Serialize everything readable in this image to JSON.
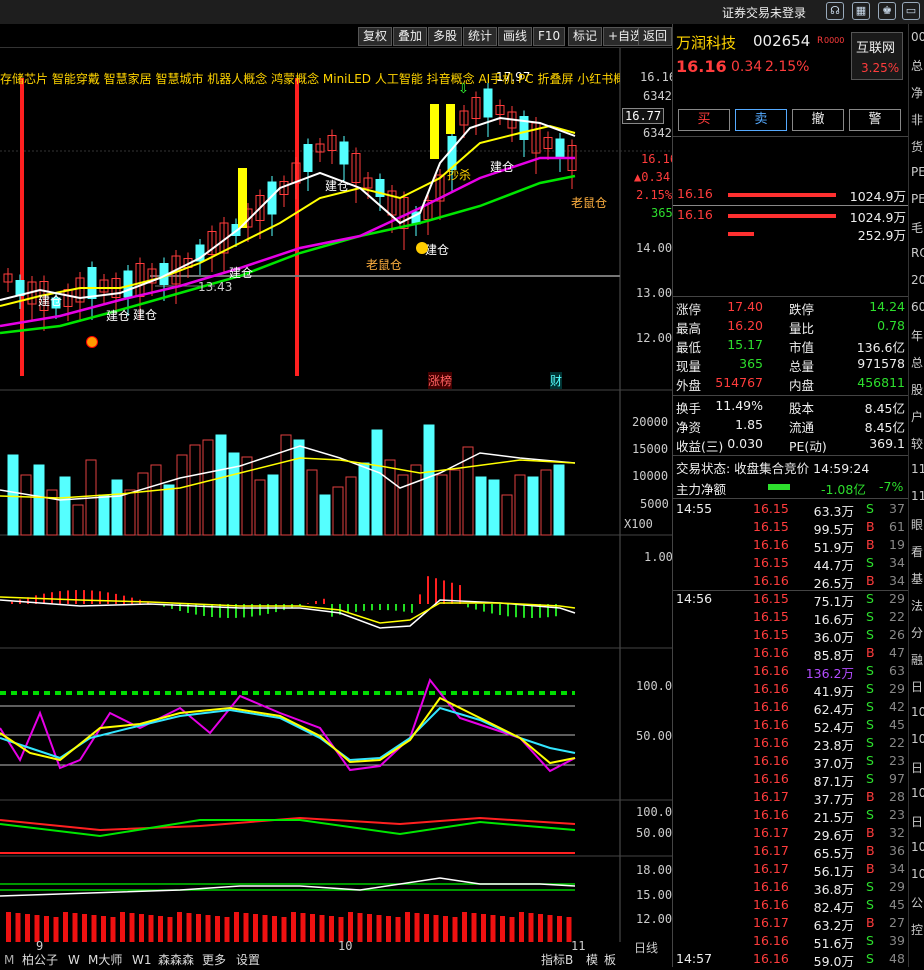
{
  "topbar": {
    "status_text": "证券交易未登录",
    "icons": [
      "headset-icon",
      "calculator-icon",
      "shirt-icon",
      "window-icon"
    ]
  },
  "toolbar": {
    "buttons": [
      "复权",
      "叠加",
      "多股",
      "统计",
      "画线",
      "F10",
      "标记",
      "+自选",
      "返回"
    ]
  },
  "concepts": "存储芯片 智能穿戴 智慧家居 智慧城市 机器人概念 鸿蒙概念 MiniLED 人工智能 抖音概念 AI手机 PC 折叠屏 小红书概",
  "price_axis": {
    "top_value": "16.16",
    "top_vol": "6342",
    "cursor_price": "16.77",
    "cursor_vol": "6342",
    "stat_price": "16.16",
    "stat_change": "▲0.34",
    "stat_pct": "2.15%",
    "stat_vol": "365",
    "ticks": [
      "14.00",
      "13.00",
      "12.00"
    ]
  },
  "chart_labels": {
    "zhangbang": "涨榜",
    "cai": "财",
    "lao1": "老鼠仓",
    "lao2": "老鼠仓",
    "jian": [
      "建仓",
      "建仓",
      "建仓",
      "建仓",
      "建仓",
      "建仓",
      "建仓"
    ],
    "hi": "17.97",
    "low": "13.43",
    "chaosha": "抄杀"
  },
  "vol_axis": {
    "ticks": [
      "20000",
      "15000",
      "10000",
      "5000"
    ],
    "unit": "X100"
  },
  "ind1_axis": {
    "ticks": [
      "1.00"
    ]
  },
  "ind2_axis": {
    "ticks": [
      "100.0",
      "50.00"
    ]
  },
  "ind3_axis": {
    "ticks": [
      "100.0",
      "50.00"
    ]
  },
  "ind4_axis": {
    "ticks": [
      "18.00",
      "15.00",
      "12.00"
    ]
  },
  "x_axis": {
    "ticks": [
      "9",
      "10",
      "11"
    ],
    "period": "日线"
  },
  "bottom_tabs": [
    "柏公子",
    "W",
    "M大师",
    "W1",
    "森森森",
    "更多",
    "设置"
  ],
  "bottom_right": [
    "指标B",
    "模",
    "板"
  ],
  "stock": {
    "name": "万润科技",
    "code": "002654",
    "tag": "R",
    "tag_extra": "0000",
    "price": "16.16",
    "change": "0.34",
    "pct": "2.15%",
    "sector": "互联网",
    "sector_pct": "3.25%"
  },
  "trade_buttons": [
    "买",
    "卖",
    "撤",
    "警"
  ],
  "order_book": [
    {
      "price": "16.16",
      "vol": "1024.9万"
    },
    {
      "price": "16.16",
      "vol": "1024.9万"
    },
    {
      "price": "",
      "vol": "252.9万"
    }
  ],
  "quote": [
    {
      "l1": "涨停",
      "v1": "17.40",
      "l2": "跌停",
      "v2": "14.24",
      "c1": "red",
      "c2": "green"
    },
    {
      "l1": "最高",
      "v1": "16.20",
      "l2": "量比",
      "v2": "0.78",
      "c1": "red",
      "c2": "green"
    },
    {
      "l1": "最低",
      "v1": "15.17",
      "l2": "市值",
      "v2": "136.6亿",
      "c1": "green",
      "c2": "wht"
    },
    {
      "l1": "现量",
      "v1": "365",
      "l2": "总量",
      "v2": "971578",
      "c1": "green",
      "c2": "wht"
    },
    {
      "l1": "外盘",
      "v1": "514767",
      "l2": "内盘",
      "v2": "456811",
      "c1": "red",
      "c2": "green"
    }
  ],
  "quote2": [
    {
      "l1": "换手",
      "v1": "11.49%",
      "l2": "股本",
      "v2": "8.45亿"
    },
    {
      "l1": "净资",
      "v1": "1.85",
      "l2": "流通",
      "v2": "8.45亿"
    },
    {
      "l1": "收益(三)",
      "v1": "0.030",
      "l2": "PE(动)",
      "v2": "369.1"
    }
  ],
  "trade_status": "交易状态: 收盘集合竞价 14:59:24",
  "main_flow": {
    "label": "主力净额",
    "value": "-1.08亿",
    "pct": "-7%"
  },
  "ticks": [
    {
      "t": "14:55",
      "p": "16.15",
      "v": "63.3万",
      "s": "S",
      "n": "37",
      "pc": "red",
      "sc": "green"
    },
    {
      "t": "",
      "p": "16.15",
      "v": "99.5万",
      "s": "B",
      "n": "61",
      "pc": "red",
      "sc": "red"
    },
    {
      "t": "",
      "p": "16.16",
      "v": "51.9万",
      "s": "B",
      "n": "19",
      "pc": "red",
      "sc": "red"
    },
    {
      "t": "",
      "p": "16.15",
      "v": "44.7万",
      "s": "S",
      "n": "34",
      "pc": "red",
      "sc": "green"
    },
    {
      "t": "",
      "p": "16.16",
      "v": "26.5万",
      "s": "B",
      "n": "34",
      "pc": "red",
      "sc": "red"
    },
    {
      "t": "14:56",
      "p": "16.15",
      "v": "75.1万",
      "s": "S",
      "n": "29",
      "pc": "red",
      "sc": "green"
    },
    {
      "t": "",
      "p": "16.15",
      "v": "16.6万",
      "s": "S",
      "n": "22",
      "pc": "red",
      "sc": "green"
    },
    {
      "t": "",
      "p": "16.15",
      "v": "36.0万",
      "s": "S",
      "n": "26",
      "pc": "red",
      "sc": "green"
    },
    {
      "t": "",
      "p": "16.16",
      "v": "85.8万",
      "s": "B",
      "n": "47",
      "pc": "red",
      "sc": "red"
    },
    {
      "t": "",
      "p": "16.16",
      "v": "136.2万",
      "s": "S",
      "n": "63",
      "pc": "red",
      "sc": "green",
      "vc": "pur"
    },
    {
      "t": "",
      "p": "16.16",
      "v": "41.9万",
      "s": "S",
      "n": "29",
      "pc": "red",
      "sc": "green"
    },
    {
      "t": "",
      "p": "16.16",
      "v": "62.4万",
      "s": "S",
      "n": "42",
      "pc": "red",
      "sc": "green"
    },
    {
      "t": "",
      "p": "16.16",
      "v": "52.4万",
      "s": "S",
      "n": "45",
      "pc": "red",
      "sc": "green"
    },
    {
      "t": "",
      "p": "16.16",
      "v": "23.8万",
      "s": "S",
      "n": "22",
      "pc": "red",
      "sc": "green"
    },
    {
      "t": "",
      "p": "16.16",
      "v": "37.0万",
      "s": "S",
      "n": "23",
      "pc": "red",
      "sc": "green"
    },
    {
      "t": "",
      "p": "16.16",
      "v": "87.1万",
      "s": "S",
      "n": "97",
      "pc": "red",
      "sc": "green"
    },
    {
      "t": "",
      "p": "16.17",
      "v": "37.7万",
      "s": "B",
      "n": "28",
      "pc": "red",
      "sc": "red"
    },
    {
      "t": "",
      "p": "16.16",
      "v": "21.5万",
      "s": "S",
      "n": "23",
      "pc": "red",
      "sc": "green"
    },
    {
      "t": "",
      "p": "16.17",
      "v": "29.6万",
      "s": "B",
      "n": "32",
      "pc": "red",
      "sc": "red"
    },
    {
      "t": "",
      "p": "16.17",
      "v": "65.5万",
      "s": "B",
      "n": "36",
      "pc": "red",
      "sc": "red"
    },
    {
      "t": "",
      "p": "16.17",
      "v": "56.1万",
      "s": "B",
      "n": "34",
      "pc": "red",
      "sc": "red"
    },
    {
      "t": "",
      "p": "16.16",
      "v": "36.8万",
      "s": "S",
      "n": "29",
      "pc": "red",
      "sc": "green"
    },
    {
      "t": "",
      "p": "16.16",
      "v": "82.4万",
      "s": "S",
      "n": "45",
      "pc": "red",
      "sc": "green"
    },
    {
      "t": "",
      "p": "16.17",
      "v": "63.2万",
      "s": "B",
      "n": "27",
      "pc": "red",
      "sc": "red"
    },
    {
      "t": "",
      "p": "16.16",
      "v": "51.6万",
      "s": "S",
      "n": "39",
      "pc": "red",
      "sc": "green"
    },
    {
      "t": "14:57",
      "p": "16.16",
      "v": "59.0万",
      "s": "S",
      "n": "48",
      "pc": "red",
      "sc": "green"
    }
  ],
  "edge_text": [
    "00",
    "总",
    "净",
    "非",
    "货",
    "PE",
    "PE",
    "毛",
    "RO",
    "20",
    "60",
    "年",
    "总",
    "股",
    "户",
    "较",
    "11",
    "11",
    "眼",
    "看",
    "基",
    "法",
    "分",
    "融",
    "日",
    "10",
    "10",
    "日",
    "10",
    "日",
    "10",
    "10",
    "公",
    "控"
  ],
  "colors": {
    "up": "#ff3c3c",
    "down": "#54ffff",
    "ma5": "#ffffff",
    "ma10": "#ffff00",
    "ma20": "#e600e6",
    "ma60": "#00e600"
  }
}
